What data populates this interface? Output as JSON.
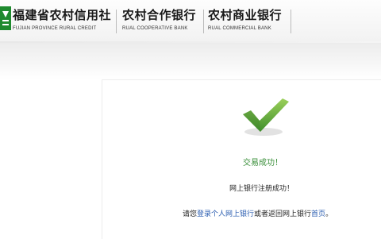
{
  "header": {
    "brands": [
      {
        "cn": "福建省农村信用社",
        "en": "FUJIAN PROVINCE RURAL CREDIT"
      },
      {
        "cn": "农村合作银行",
        "en": "RUAL COOPERATIVE BANK"
      },
      {
        "cn": "农村商业银行",
        "en": "RUAL COMMERCIAL BANK"
      }
    ],
    "logo_color": "#1f8a2e"
  },
  "result": {
    "status": "交易成功！",
    "message": "网上银行注册成功！",
    "guide": {
      "prefix": "请您",
      "login_link": "登录个人网上银行",
      "middle": "或者返回网上银行",
      "home_link": "首页",
      "suffix": "。"
    },
    "icon": "checkmark-icon",
    "accent": "#3a8f3a"
  }
}
